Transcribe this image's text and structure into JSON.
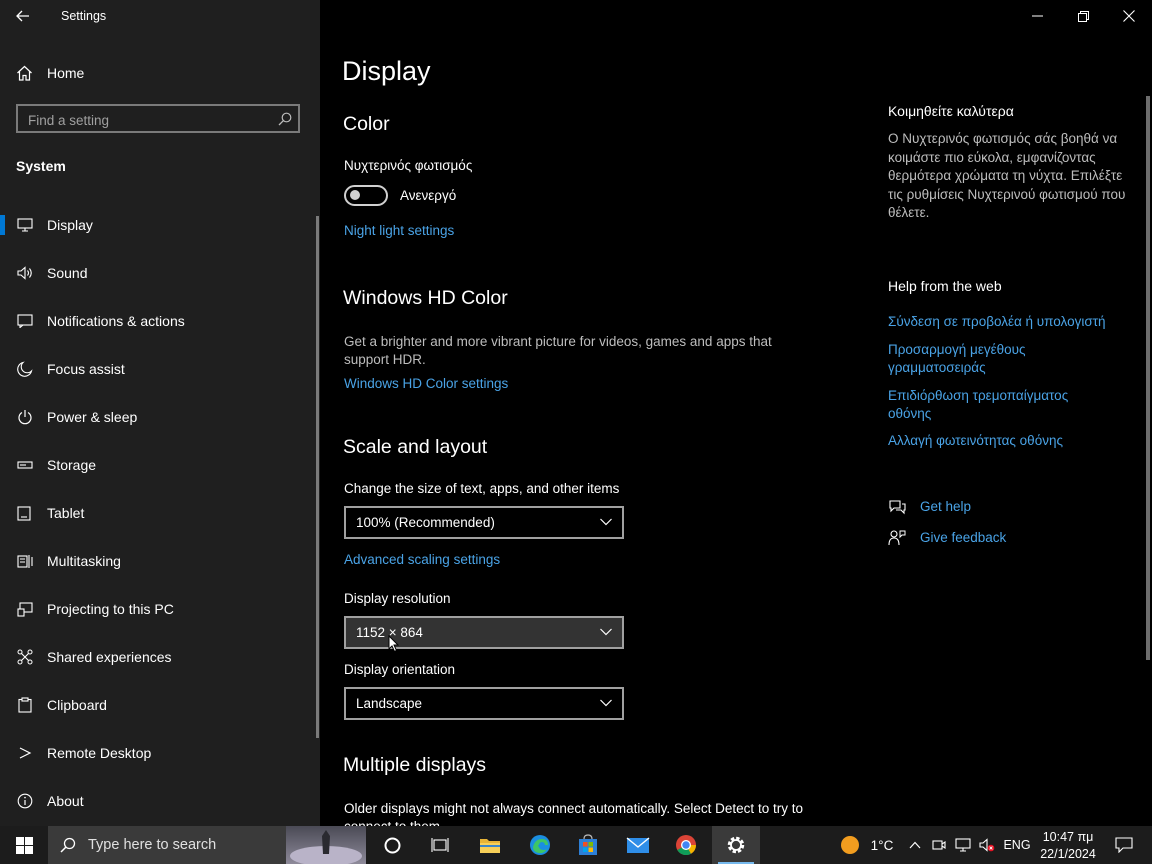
{
  "window": {
    "title": "Settings"
  },
  "sidebar": {
    "home_label": "Home",
    "search_placeholder": "Find a setting",
    "section_label": "System",
    "items": [
      {
        "label": "Display",
        "icon": "monitor-icon",
        "selected": true
      },
      {
        "label": "Sound",
        "icon": "speaker-icon"
      },
      {
        "label": "Notifications & actions",
        "icon": "message-icon"
      },
      {
        "label": "Focus assist",
        "icon": "moon-icon"
      },
      {
        "label": "Power & sleep",
        "icon": "power-icon"
      },
      {
        "label": "Storage",
        "icon": "storage-icon"
      },
      {
        "label": "Tablet",
        "icon": "tablet-icon"
      },
      {
        "label": "Multitasking",
        "icon": "multitasking-icon"
      },
      {
        "label": "Projecting to this PC",
        "icon": "projecting-icon"
      },
      {
        "label": "Shared experiences",
        "icon": "shared-icon"
      },
      {
        "label": "Clipboard",
        "icon": "clipboard-icon"
      },
      {
        "label": "Remote Desktop",
        "icon": "remote-desktop-icon"
      },
      {
        "label": "About",
        "icon": "info-icon"
      }
    ]
  },
  "main": {
    "title": "Display",
    "color": {
      "heading": "Color",
      "night_light_label": "Νυχτερινός φωτισμός",
      "night_light_state": "Ανενεργό",
      "night_light_on": false,
      "night_light_settings_link": "Night light settings"
    },
    "hd_color": {
      "heading": "Windows HD Color",
      "description": "Get a brighter and more vibrant picture for videos, games and apps that support HDR.",
      "link": "Windows HD Color settings"
    },
    "scale": {
      "heading": "Scale and layout",
      "size_label": "Change the size of text, apps, and other items",
      "size_value": "100% (Recommended)",
      "advanced_link": "Advanced scaling settings",
      "resolution_label": "Display resolution",
      "resolution_value": "1152 × 864",
      "orientation_label": "Display orientation",
      "orientation_value": "Landscape"
    },
    "multiple": {
      "heading": "Multiple displays",
      "description": "Older displays might not always connect automatically. Select Detect to try to connect to them."
    }
  },
  "aside": {
    "sleep_heading": "Κοιμηθείτε καλύτερα",
    "sleep_text": "Ο Νυχτερινός φωτισμός σάς βοηθά να κοιμάστε πιο εύκολα, εμφανίζοντας θερμότερα χρώματα τη νύχτα. Επιλέξτε τις ρυθμίσεις Νυχτερινού φωτισμού που θέλετε.",
    "help_heading": "Help from the web",
    "help_links": [
      "Σύνδεση σε προβολέα ή υπολογιστή",
      "Προσαρμογή μεγέθους γραμματοσειράς",
      "Επιδιόρθωση τρεμοπαίγματος οθόνης",
      "Αλλαγή φωτεινότητας οθόνης"
    ],
    "get_help": "Get help",
    "give_feedback": "Give feedback"
  },
  "taskbar": {
    "search_placeholder": "Type here to search",
    "weather_temp": "1°C",
    "language": "ENG",
    "time": "10:47 πμ",
    "date": "22/1/2024"
  },
  "colors": {
    "accent": "#0078d4",
    "link": "#4aa3e6",
    "sidebar_bg": "#1f1f1f",
    "taskbar_bg": "#1c1c1c"
  }
}
